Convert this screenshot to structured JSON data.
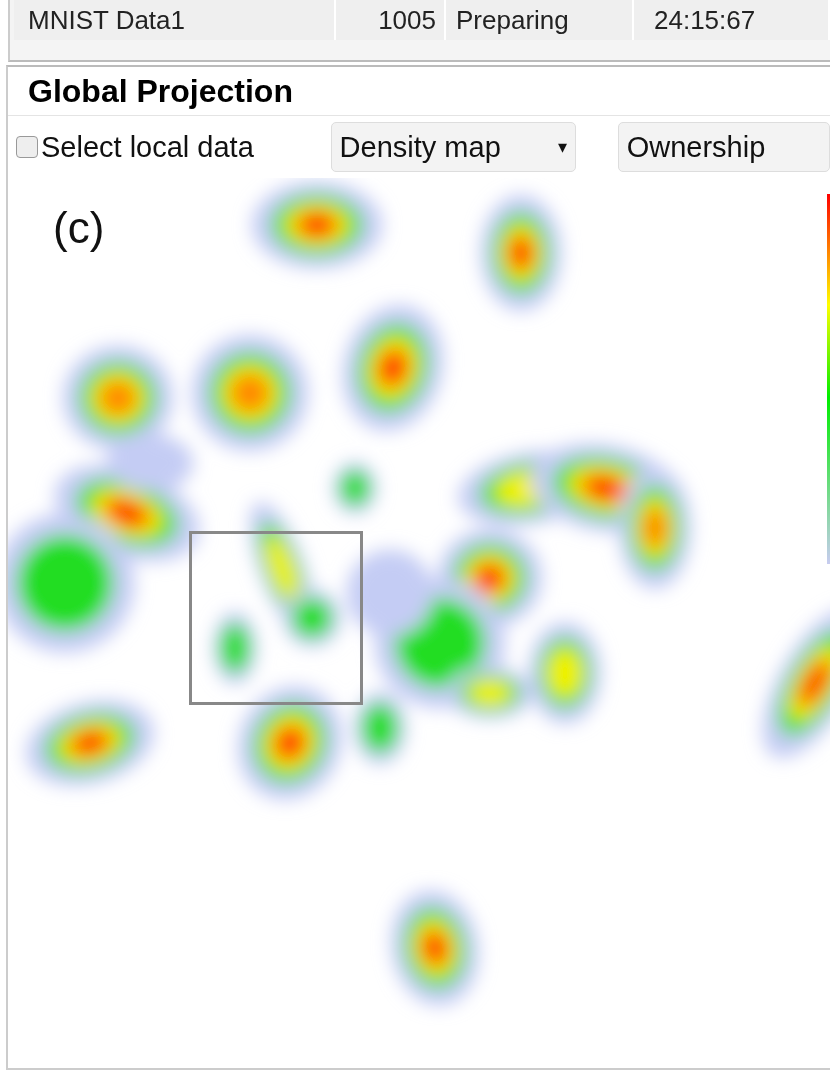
{
  "table": {
    "rows": [
      {
        "cells": [
          "MNIST Data1",
          "1005",
          "Preparing",
          "24:15:67"
        ]
      }
    ]
  },
  "panel": {
    "title": "Global Projection",
    "toolbar": {
      "checkbox": {
        "label": "Select local data",
        "checked": false
      },
      "dropdowns": [
        {
          "value": "Density map",
          "caret": "▾"
        },
        {
          "value": "Ownership"
        }
      ]
    },
    "plot": {
      "label": "(c)",
      "selection": true
    }
  }
}
